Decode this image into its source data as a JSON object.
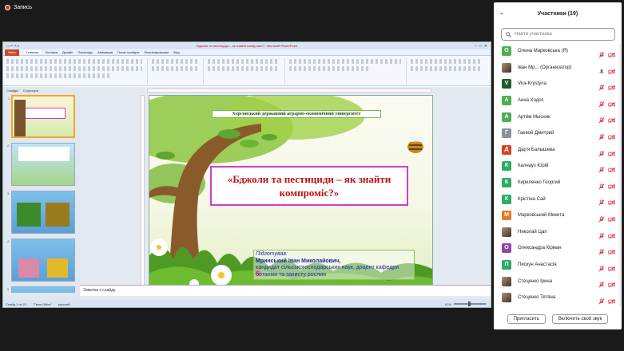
{
  "recording": {
    "label": "Запись"
  },
  "powerpoint": {
    "title": "Бджоли та пестициди – як знайти компроміс? - Microsoft PowerPoint",
    "tabs": [
      "Файл",
      "Главная",
      "Вставка",
      "Дизайн",
      "Переходы",
      "Анимация",
      "Показ слайдов",
      "Рецензирование",
      "Вид"
    ],
    "pane_tabs": [
      "Слайды",
      "Структура"
    ],
    "slide_numbers": [
      "1",
      "2",
      "3",
      "4",
      "5"
    ],
    "slide": {
      "university": "Херсонський державний аграрно-економічний університет",
      "title": "«Бджоли та пестициди – як знайти компроміс?»",
      "credits_label": "Підготував:",
      "credits_name": "Мринський Іван Миколайович,",
      "credits_role": "кандидат сільськогосподарських наук, доцент кафедри ботаніки та захисту рослин"
    },
    "notes_placeholder": "Заметки к слайду",
    "status": {
      "slide": "Слайд 1 из 21",
      "theme": "\"Тема Office\"",
      "lang": "русский",
      "zoom": "61%"
    }
  },
  "participants": {
    "title": "Участники (19)",
    "search_placeholder": "Найти участника",
    "items": [
      {
        "name": "Олена Марковська (Я)",
        "initial": "О",
        "color": "#4caf50",
        "photo": false,
        "mic_muted": true
      },
      {
        "name": "Іван Мр... (Организатор)",
        "initial": "",
        "color": "#6d5a4a",
        "photo": true,
        "mic_muted": false
      },
      {
        "name": "Vira-Krystyna",
        "initial": "V",
        "color": "#1e5c2e",
        "photo": false,
        "mic_muted": true
      },
      {
        "name": "Анна Ходос",
        "initial": "А",
        "color": "#4caf50",
        "photo": false,
        "mic_muted": true
      },
      {
        "name": "Артём Мысник",
        "initial": "А",
        "color": "#4caf50",
        "photo": false,
        "mic_muted": true
      },
      {
        "name": "Гаевой Дмитрий",
        "initial": "Г",
        "color": "#8a9099",
        "photo": false,
        "mic_muted": true
      },
      {
        "name": "Дар'я Балышева",
        "initial": "Д",
        "color": "#d8431f",
        "photo": false,
        "mic_muted": true
      },
      {
        "name": "Калнауз Юрій",
        "initial": "К",
        "color": "#2eaa6a",
        "photo": false,
        "mic_muted": true
      },
      {
        "name": "Кириленко Георгий",
        "initial": "К",
        "color": "#2eaa6a",
        "photo": false,
        "mic_muted": true
      },
      {
        "name": "Крістіна Сай",
        "initial": "К",
        "color": "#2eaa6a",
        "photo": false,
        "mic_muted": true
      },
      {
        "name": "Марковський Микита",
        "initial": "М",
        "color": "#e07b22",
        "photo": false,
        "mic_muted": true
      },
      {
        "name": "Николай Цап",
        "initial": "",
        "color": "#333",
        "photo": true,
        "mic_muted": true
      },
      {
        "name": "Олександра Кірман",
        "initial": "О",
        "color": "#8e44ad",
        "photo": false,
        "mic_muted": true
      },
      {
        "name": "Пискун Анастасія",
        "initial": "П",
        "color": "#2eaa6a",
        "photo": false,
        "mic_muted": true
      },
      {
        "name": "Стеценко Ірина",
        "initial": "",
        "color": "#555",
        "photo": true,
        "mic_muted": true
      },
      {
        "name": "Стеценко Тетяна",
        "initial": "",
        "color": "#555",
        "photo": true,
        "mic_muted": true
      }
    ],
    "invite_label": "Пригласить",
    "unmute_label": "Включить свой звук"
  }
}
